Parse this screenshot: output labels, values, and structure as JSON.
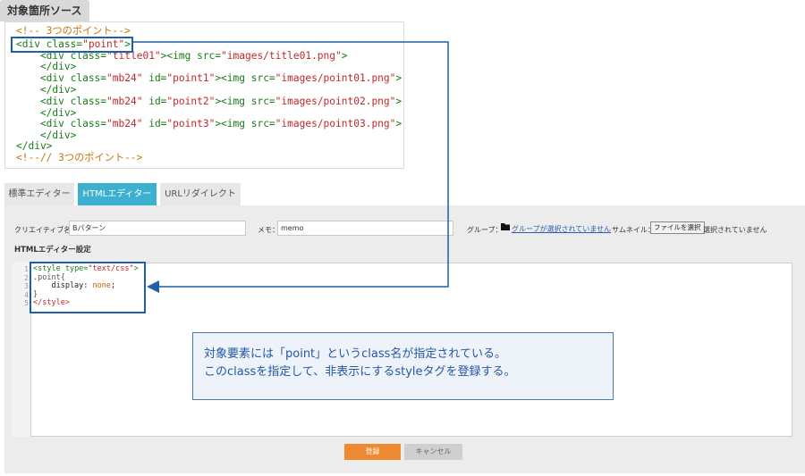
{
  "source": {
    "tab_label": "対象箇所ソース",
    "lines": [
      [
        "<!-- 3つのポイント-->"
      ],
      [
        "<div class=",
        "\"point\"",
        ">"
      ],
      [
        "    <div class=",
        "\"title01\"",
        "><img src=",
        "\"images/title01.png\"",
        ">"
      ],
      [
        "    </div>"
      ],
      [
        "    <div class=",
        "\"mb24\"",
        " id=",
        "\"point1\"",
        "><img src=",
        "\"images/point01.png\"",
        ">"
      ],
      [
        "    </div>"
      ],
      [
        "    <div class=",
        "\"mb24\"",
        " id=",
        "\"point2\"",
        "><img src=",
        "\"images/point02.png\"",
        ">"
      ],
      [
        "    </div>"
      ],
      [
        "    <div class=",
        "\"mb24\"",
        " id=",
        "\"point3\"",
        "><img src=",
        "\"images/point03.png\"",
        ">"
      ],
      [
        "    </div>"
      ],
      [
        "</div>"
      ],
      [
        "<!--// 3つのポイント-->"
      ]
    ]
  },
  "tabs": [
    {
      "label": "標準エディター",
      "active": false
    },
    {
      "label": "HTMLエディター",
      "active": true
    },
    {
      "label": "URLリダイレクト",
      "active": false
    }
  ],
  "form": {
    "creative_name_label": "クリエイティブ名：",
    "creative_name_value": "Bパターン",
    "memo_label": "メモ：",
    "memo_value": "memo",
    "group_label": "グループ：",
    "group_link": "グループが選択されていません",
    "thumbnail_label": "サムネイル：",
    "file_button": "ファイルを選択",
    "file_status": "選択されていません",
    "section_title": "HTMLエディター設定"
  },
  "editor": {
    "line_numbers": [
      "1",
      "2",
      "3",
      "4",
      "5"
    ],
    "lines": [
      [
        "<style ",
        "type=",
        "\"text/css\"",
        ">"
      ],
      [
        ".point{"
      ],
      [
        "    display",
        ": ",
        "none",
        ";"
      ],
      [
        "}"
      ],
      [
        "</style>"
      ]
    ]
  },
  "note": {
    "line1": "対象要素には「point」というclass名が指定されている。",
    "line2": "このclassを指定して、非表示にするstyleタグを登録する。"
  },
  "buttons": {
    "register": "登録",
    "cancel": "キャンセル"
  },
  "colors": {
    "accent_tab": "#3bb0cf",
    "callout": "#1f5ea8",
    "register_button": "#f08a32"
  }
}
